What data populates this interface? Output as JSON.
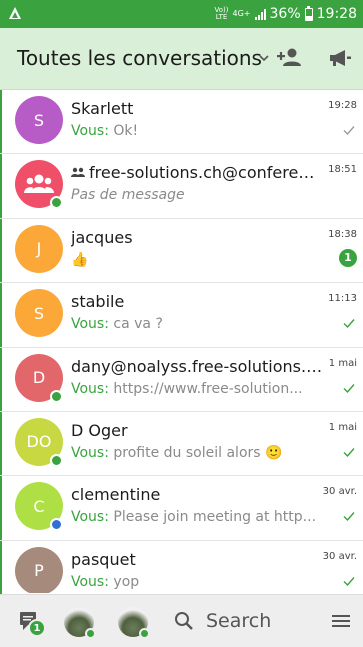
{
  "status_bar": {
    "volte": "Vo)) LTE",
    "network": "4G+",
    "battery": "36%",
    "battery_level": 0.36,
    "time": "19:28"
  },
  "header": {
    "title": "Toutes les conversations",
    "dropdown_icon": "chevron-down-icon",
    "add_contact_icon": "add-contact-icon",
    "broadcast_icon": "megaphone-icon"
  },
  "colors": {
    "accent": "#3aa33f",
    "header_bg": "#d9efd7"
  },
  "conversations": [
    {
      "initials": "S",
      "avatar_color": "#b75cc7",
      "name": "Skarlett",
      "you_prefix": "Vous:",
      "preview": " Ok!",
      "time": "19:28",
      "status": "sent",
      "presence": ""
    },
    {
      "initials": "",
      "avatar_color": "#ef4f68",
      "name": "free-solutions.ch@conferen...",
      "conference": true,
      "you_prefix": "",
      "preview": "Pas de message",
      "time": "18:51",
      "status": "",
      "presence": "#3aa33f"
    },
    {
      "initials": "J",
      "avatar_color": "#fba839",
      "name": "jacques",
      "you_prefix": "",
      "preview": "👍",
      "time": "18:38",
      "status": "",
      "unread": "1",
      "presence": ""
    },
    {
      "initials": "S",
      "avatar_color": "#fba839",
      "name": "stabile",
      "you_prefix": "Vous:",
      "preview": " ca va ?",
      "time": "11:13",
      "status": "read",
      "presence": ""
    },
    {
      "initials": "D",
      "avatar_color": "#e2676a",
      "name": "dany@noalyss.free-solutions.org",
      "you_prefix": "Vous:",
      "preview": " https://www.free-solution...",
      "time": "1 mai",
      "status": "read",
      "presence": "#3aa33f"
    },
    {
      "initials": "DO",
      "avatar_color": "#c7d842",
      "name": "D Oger",
      "you_prefix": "Vous:",
      "preview": " profite du soleil alors 🙂",
      "time": "1 mai",
      "status": "read",
      "presence": "#3aa33f"
    },
    {
      "initials": "C",
      "avatar_color": "#aee046",
      "name": "clementine",
      "you_prefix": "Vous:",
      "preview": " Please join meeting at http...",
      "time": "30 avr.",
      "status": "read",
      "presence": "#2f6fd7"
    },
    {
      "initials": "P",
      "avatar_color": "#a68a7b",
      "name": "pasquet",
      "you_prefix": "Vous:",
      "preview": " yop",
      "time": "30 avr.",
      "status": "read",
      "presence": ""
    }
  ],
  "bottom_bar": {
    "chats_badge": "1",
    "search_label": "Search",
    "menu_icon": "hamburger-menu-icon"
  }
}
